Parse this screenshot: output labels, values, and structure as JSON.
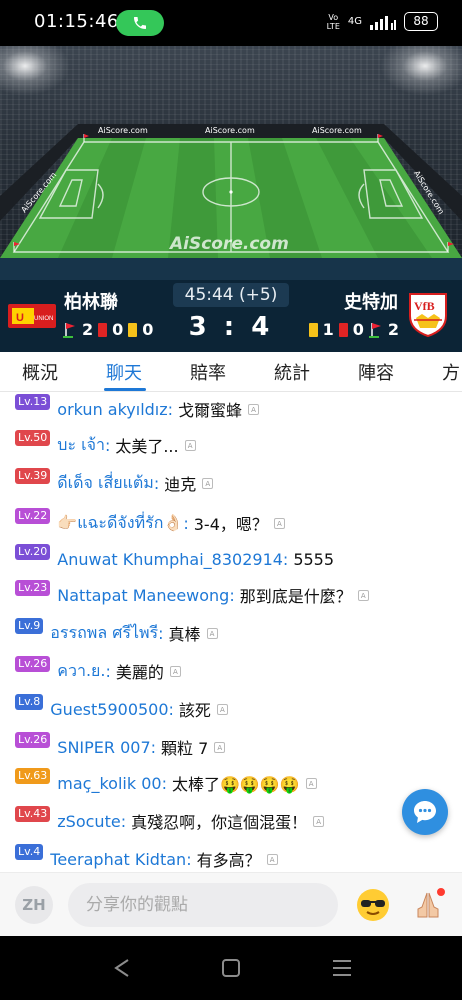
{
  "status_bar": {
    "time": "01:15:46",
    "volte_top": "Vo",
    "volte_bottom": "LTE",
    "network": "4G",
    "battery": "88"
  },
  "pitch": {
    "brand": "AiScore.com",
    "ad_board": "AiScore.com"
  },
  "match": {
    "home_team": "柏林聯",
    "away_team": "史特加",
    "time": "45:44 (+5)",
    "score": "3 : 4",
    "home_corners": "2",
    "home_red": "0",
    "home_yellow": "0",
    "away_yellow": "1",
    "away_red": "0",
    "away_corners": "2"
  },
  "tabs": [
    {
      "label": "概況"
    },
    {
      "label": "聊天"
    },
    {
      "label": "賠率"
    },
    {
      "label": "統計"
    },
    {
      "label": "陣容"
    },
    {
      "label": "方"
    }
  ],
  "messages": [
    {
      "level": "Lv.13",
      "level_color": "#7b4fd6",
      "user": "orkun akyıldız",
      "text": "戈爾蜜蜂"
    },
    {
      "level": "Lv.50",
      "level_color": "#e0474c",
      "user": "บะ เจ้า",
      "text": "太美了..."
    },
    {
      "level": "Lv.39",
      "level_color": "#e0474c",
      "user": "ดีเด็จ เสี่ยแต้ม",
      "text": "迪克"
    },
    {
      "level": "Lv.22",
      "level_color": "#b84fd6",
      "user": "👉🏻แฉะดีจังที่รัก👌🏻",
      "text": "3-4，嗯？"
    },
    {
      "level": "Lv.20",
      "level_color": "#7b4fd6",
      "user": "Anuwat Khumphai_8302914",
      "text": "5555"
    },
    {
      "level": "Lv.23",
      "level_color": "#b84fd6",
      "user": "Nattapat Maneewong",
      "text": "那到底是什麼？"
    },
    {
      "level": "Lv.9",
      "level_color": "#3b6fd8",
      "user": "อรรถพล ศรีไพรี",
      "text": "真棒"
    },
    {
      "level": "Lv.26",
      "level_color": "#b84fd6",
      "user": "ควา.ย.",
      "text": "美麗的"
    },
    {
      "level": "Lv.8",
      "level_color": "#3b6fd8",
      "user": "Guest5900500",
      "text": "該死"
    },
    {
      "level": "Lv.26",
      "level_color": "#b84fd6",
      "user": "SNIPER 007",
      "text": "顆粒 7"
    },
    {
      "level": "Lv.63",
      "level_color": "#f09a1b",
      "user": "maç_kolik 00",
      "text": "太棒了🤑🤑🤑🤑"
    },
    {
      "level": "Lv.43",
      "level_color": "#e0474c",
      "user": "zSocute",
      "text": "真殘忍啊，你這個混蛋！"
    },
    {
      "level": "Lv.4",
      "level_color": "#3b6fd8",
      "user": "Teeraphat Kidtan",
      "text": "有多高？"
    }
  ],
  "translate_badge": "A",
  "input": {
    "lang": "ZH",
    "placeholder": "分享你的觀點"
  },
  "colors": {
    "accent": "#1e78d6",
    "scorebar": "#0c2436",
    "pitch_green": "#3f9a3a"
  },
  "icons": {
    "call": "phone-icon",
    "chat_float": "chat-bubble-icon",
    "emoji": "sunglasses-emoji-icon",
    "gift": "praying-hands-icon"
  }
}
